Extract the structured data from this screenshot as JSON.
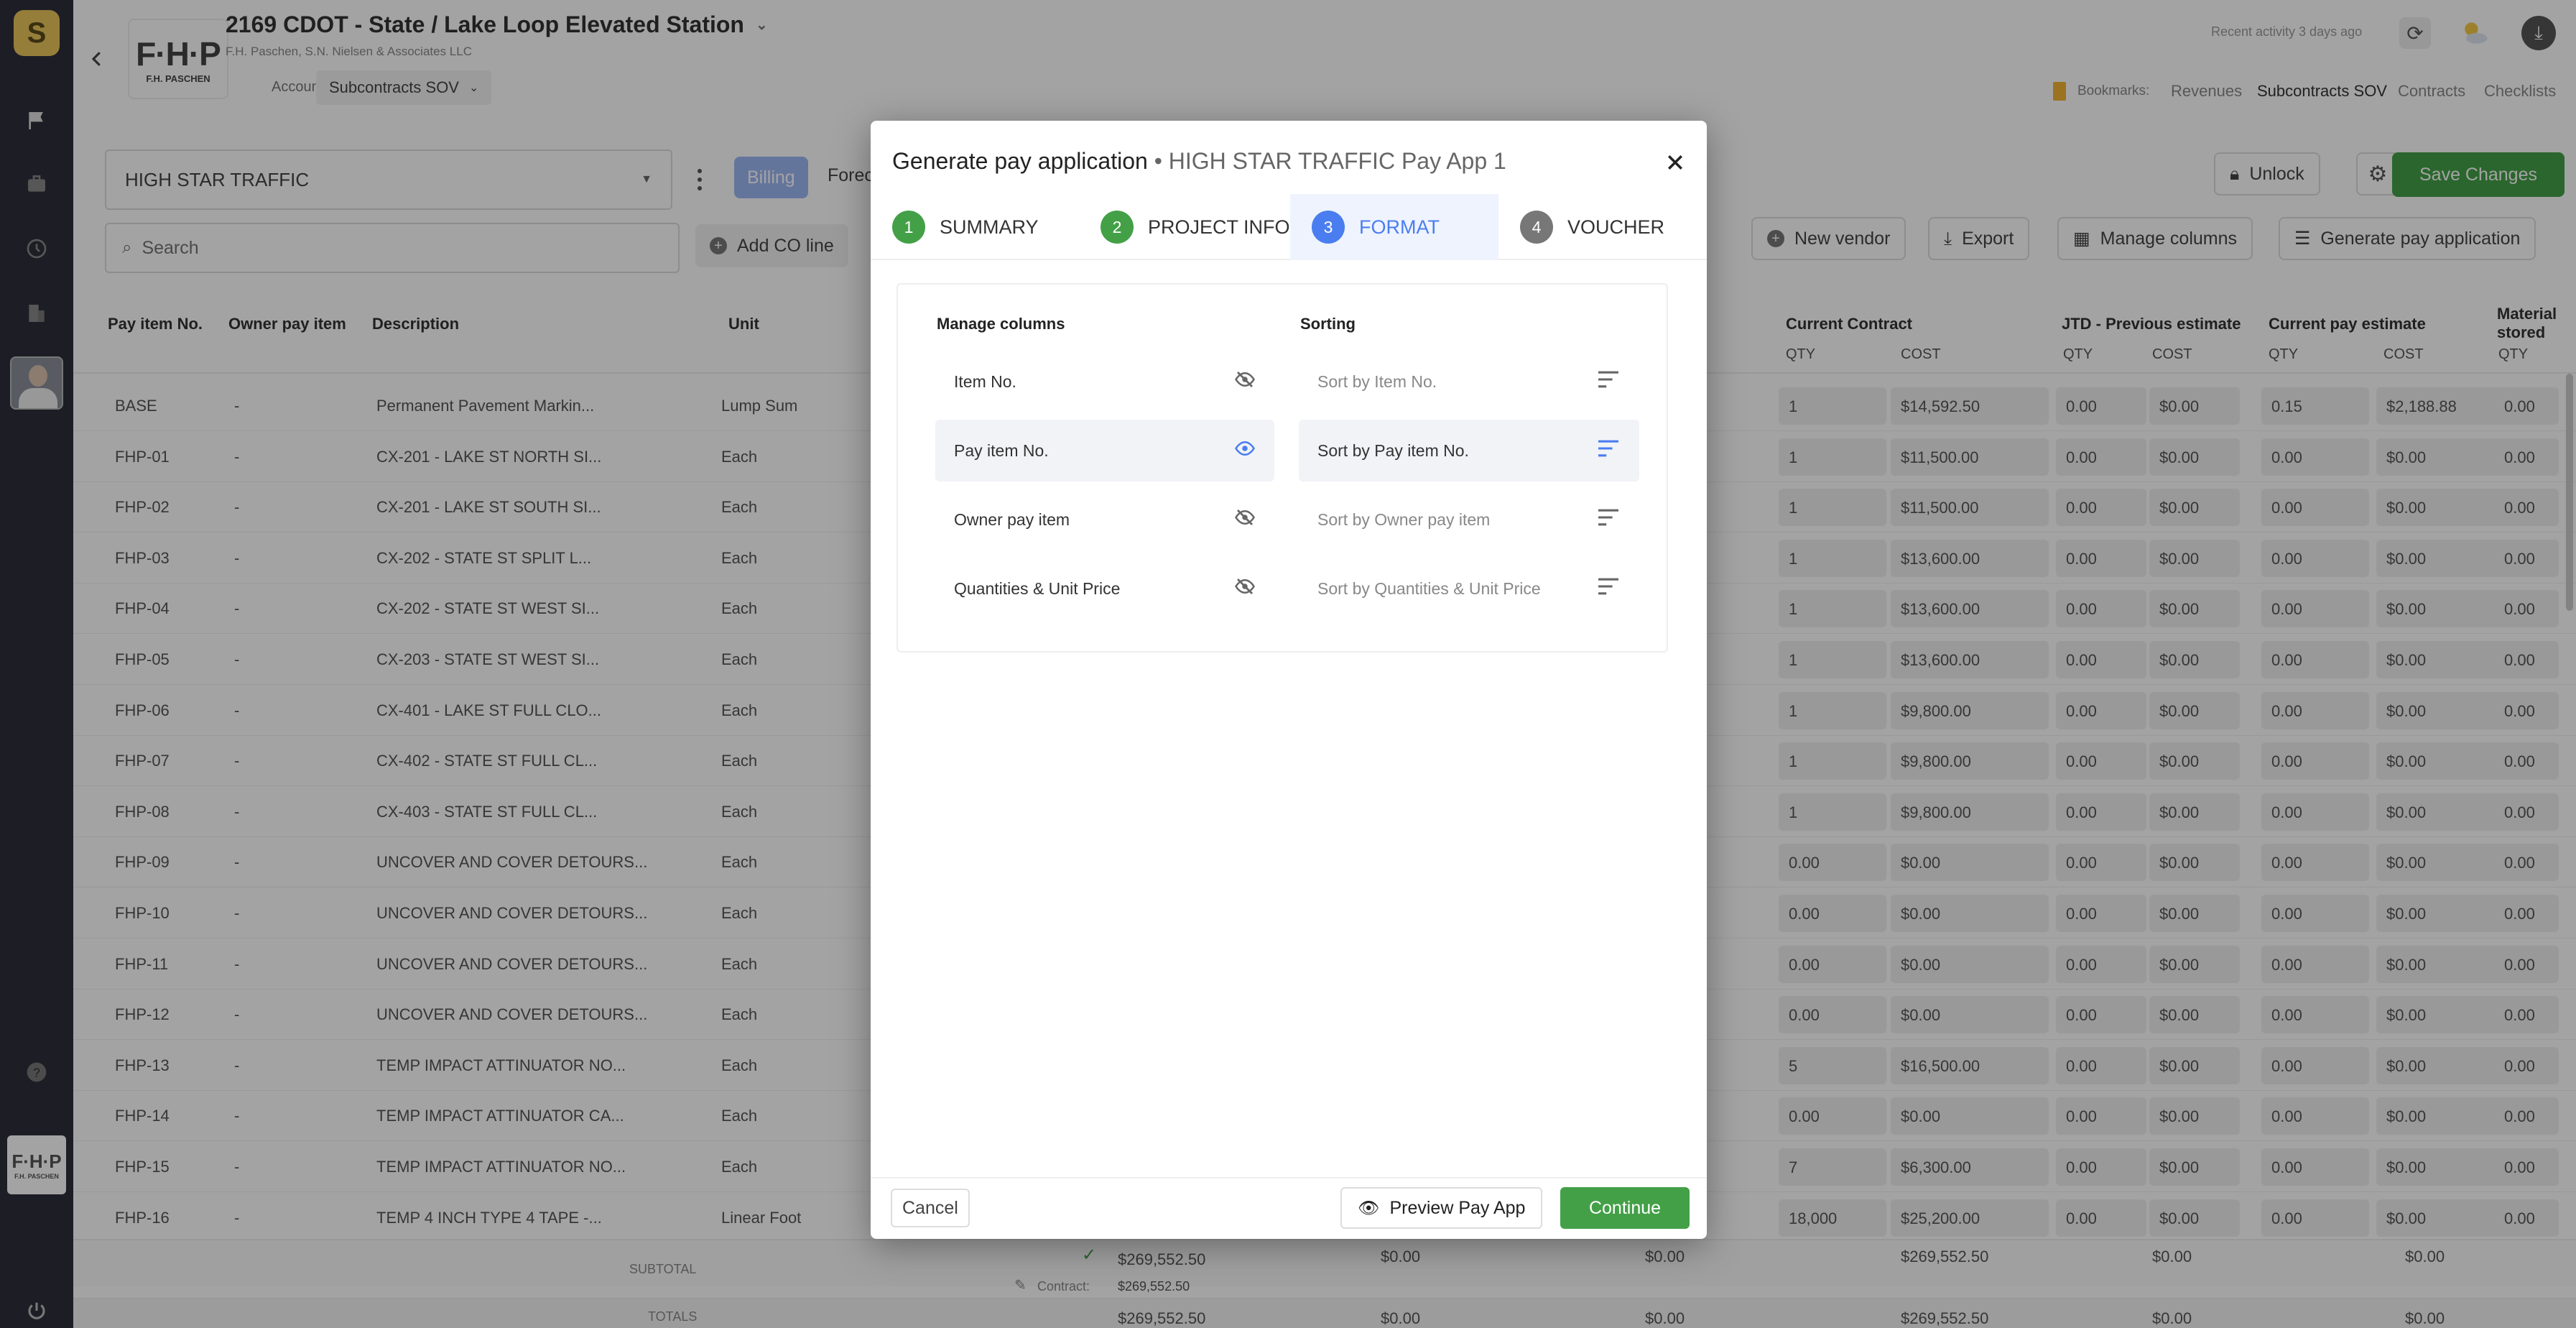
{
  "brand": {
    "logo_letter": "S",
    "company_logo_text": "F·H·P",
    "company_logo_sub": "F.H. PASCHEN"
  },
  "header": {
    "title": "2169 CDOT - State / Lake Loop Elevated Station",
    "subtitle": "F.H. Paschen, S.N. Nielsen & Associates LLC",
    "crumb_accounting": "Accounting",
    "crumb_select": "Subcontracts SOV",
    "recent_activity": "Recent activity 3 days ago",
    "bookmarks_label": "Bookmarks:",
    "bookmarks": [
      "Revenues",
      "Subcontracts SOV",
      "Contracts",
      "Checklists"
    ]
  },
  "toolbar": {
    "vendor_select": "HIGH STAR TRAFFIC",
    "tab_billing": "Billing",
    "tab_forecast": "Forec",
    "unlock": "Unlock",
    "save": "Save Changes",
    "search_placeholder": "Search",
    "add_co_line": "Add CO line",
    "new_vendor": "New vendor",
    "export": "Export",
    "manage_columns": "Manage columns",
    "generate_pay_app": "Generate pay application"
  },
  "table": {
    "headers": {
      "pay_item_no": "Pay item No.",
      "owner_pay_item": "Owner pay item",
      "description": "Description",
      "unit": "Unit",
      "current_contract": "Current Contract",
      "jtd_previous": "JTD - Previous estimate",
      "current_pay_estimate": "Current pay estimate",
      "material_stored": "Material stored",
      "qty": "QTY",
      "cost": "COST"
    },
    "rows": [
      {
        "no": "BASE",
        "owner": "-",
        "desc": "Permanent Pavement Markin...",
        "unit": "Lump Sum",
        "cc_qty": "1",
        "cc_cost": "$14,592.50",
        "jtd_qty": "0.00",
        "jtd_cost": "$0.00",
        "cur_qty": "0.15",
        "cur_cost": "$2,188.88",
        "mat_qty": "0.00"
      },
      {
        "no": "FHP-01",
        "owner": "-",
        "desc": "CX-201 - LAKE ST NORTH SI...",
        "unit": "Each",
        "cc_qty": "1",
        "cc_cost": "$11,500.00",
        "jtd_qty": "0.00",
        "jtd_cost": "$0.00",
        "cur_qty": "0.00",
        "cur_cost": "$0.00",
        "mat_qty": "0.00"
      },
      {
        "no": "FHP-02",
        "owner": "-",
        "desc": "CX-201 - LAKE ST SOUTH SI...",
        "unit": "Each",
        "cc_qty": "1",
        "cc_cost": "$11,500.00",
        "jtd_qty": "0.00",
        "jtd_cost": "$0.00",
        "cur_qty": "0.00",
        "cur_cost": "$0.00",
        "mat_qty": "0.00"
      },
      {
        "no": "FHP-03",
        "owner": "-",
        "desc": "CX-202 - STATE ST SPLIT L...",
        "unit": "Each",
        "cc_qty": "1",
        "cc_cost": "$13,600.00",
        "jtd_qty": "0.00",
        "jtd_cost": "$0.00",
        "cur_qty": "0.00",
        "cur_cost": "$0.00",
        "mat_qty": "0.00"
      },
      {
        "no": "FHP-04",
        "owner": "-",
        "desc": "CX-202 - STATE ST WEST SI...",
        "unit": "Each",
        "cc_qty": "1",
        "cc_cost": "$13,600.00",
        "jtd_qty": "0.00",
        "jtd_cost": "$0.00",
        "cur_qty": "0.00",
        "cur_cost": "$0.00",
        "mat_qty": "0.00"
      },
      {
        "no": "FHP-05",
        "owner": "-",
        "desc": "CX-203 - STATE ST WEST SI...",
        "unit": "Each",
        "cc_qty": "1",
        "cc_cost": "$13,600.00",
        "jtd_qty": "0.00",
        "jtd_cost": "$0.00",
        "cur_qty": "0.00",
        "cur_cost": "$0.00",
        "mat_qty": "0.00"
      },
      {
        "no": "FHP-06",
        "owner": "-",
        "desc": "CX-401 - LAKE ST FULL CLO...",
        "unit": "Each",
        "cc_qty": "1",
        "cc_cost": "$9,800.00",
        "jtd_qty": "0.00",
        "jtd_cost": "$0.00",
        "cur_qty": "0.00",
        "cur_cost": "$0.00",
        "mat_qty": "0.00"
      },
      {
        "no": "FHP-07",
        "owner": "-",
        "desc": "CX-402 - STATE ST FULL CL...",
        "unit": "Each",
        "cc_qty": "1",
        "cc_cost": "$9,800.00",
        "jtd_qty": "0.00",
        "jtd_cost": "$0.00",
        "cur_qty": "0.00",
        "cur_cost": "$0.00",
        "mat_qty": "0.00"
      },
      {
        "no": "FHP-08",
        "owner": "-",
        "desc": "CX-403 - STATE ST FULL CL...",
        "unit": "Each",
        "cc_qty": "1",
        "cc_cost": "$9,800.00",
        "jtd_qty": "0.00",
        "jtd_cost": "$0.00",
        "cur_qty": "0.00",
        "cur_cost": "$0.00",
        "mat_qty": "0.00"
      },
      {
        "no": "FHP-09",
        "owner": "-",
        "desc": "UNCOVER AND COVER DETOURS...",
        "unit": "Each",
        "cc_qty": "0.00",
        "cc_cost": "$0.00",
        "jtd_qty": "0.00",
        "jtd_cost": "$0.00",
        "cur_qty": "0.00",
        "cur_cost": "$0.00",
        "mat_qty": "0.00"
      },
      {
        "no": "FHP-10",
        "owner": "-",
        "desc": "UNCOVER AND COVER DETOURS...",
        "unit": "Each",
        "cc_qty": "0.00",
        "cc_cost": "$0.00",
        "jtd_qty": "0.00",
        "jtd_cost": "$0.00",
        "cur_qty": "0.00",
        "cur_cost": "$0.00",
        "mat_qty": "0.00"
      },
      {
        "no": "FHP-11",
        "owner": "-",
        "desc": "UNCOVER AND COVER DETOURS...",
        "unit": "Each",
        "cc_qty": "0.00",
        "cc_cost": "$0.00",
        "jtd_qty": "0.00",
        "jtd_cost": "$0.00",
        "cur_qty": "0.00",
        "cur_cost": "$0.00",
        "mat_qty": "0.00"
      },
      {
        "no": "FHP-12",
        "owner": "-",
        "desc": "UNCOVER AND COVER DETOURS...",
        "unit": "Each",
        "cc_qty": "0.00",
        "cc_cost": "$0.00",
        "jtd_qty": "0.00",
        "jtd_cost": "$0.00",
        "cur_qty": "0.00",
        "cur_cost": "$0.00",
        "mat_qty": "0.00"
      },
      {
        "no": "FHP-13",
        "owner": "-",
        "desc": "TEMP IMPACT ATTINUATOR NO...",
        "unit": "Each",
        "cc_qty": "5",
        "cc_cost": "$16,500.00",
        "jtd_qty": "0.00",
        "jtd_cost": "$0.00",
        "cur_qty": "0.00",
        "cur_cost": "$0.00",
        "mat_qty": "0.00"
      },
      {
        "no": "FHP-14",
        "owner": "-",
        "desc": "TEMP IMPACT ATTINUATOR CA...",
        "unit": "Each",
        "cc_qty": "0.00",
        "cc_cost": "$0.00",
        "jtd_qty": "0.00",
        "jtd_cost": "$0.00",
        "cur_qty": "0.00",
        "cur_cost": "$0.00",
        "mat_qty": "0.00"
      },
      {
        "no": "FHP-15",
        "owner": "-",
        "desc": "TEMP IMPACT ATTINUATOR NO...",
        "unit": "Each",
        "cc_qty": "7",
        "cc_cost": "$6,300.00",
        "jtd_qty": "0.00",
        "jtd_cost": "$0.00",
        "cur_qty": "0.00",
        "cur_cost": "$0.00",
        "mat_qty": "0.00"
      },
      {
        "no": "FHP-16",
        "owner": "-",
        "desc": "TEMP 4 INCH TYPE 4 TAPE -...",
        "unit": "Linear Foot",
        "cc_qty": "18,000",
        "cc_cost": "$25,200.00",
        "jtd_qty": "0.00",
        "jtd_cost": "$0.00",
        "cur_qty": "0.00",
        "cur_cost": "$0.00",
        "mat_qty": "0.00"
      }
    ],
    "subtotal_label": "SUBTOTAL",
    "totals_label": "TOTALS",
    "contract_label": "Contract:",
    "subtotal_values": [
      "$269,552.50",
      "$0.00",
      "$0.00",
      "$269,552.50",
      "$0.00",
      "$0.00"
    ],
    "contract_value": "$269,552.50",
    "totals_values": [
      "$269,552.50",
      "$0.00",
      "$0.00",
      "$269,552.50",
      "$0.00",
      "$0.00"
    ]
  },
  "modal": {
    "title": "Generate pay application",
    "subtitle": "• HIGH STAR TRAFFIC Pay App 1",
    "tabs": [
      {
        "num": "1",
        "label": "SUMMARY"
      },
      {
        "num": "2",
        "label": "PROJECT INFO"
      },
      {
        "num": "3",
        "label": "FORMAT"
      },
      {
        "num": "4",
        "label": "VOUCHER"
      }
    ],
    "manage_columns_title": "Manage columns",
    "sorting_title": "Sorting",
    "columns": [
      "Item No.",
      "Pay item No.",
      "Owner pay item",
      "Quantities & Unit Price"
    ],
    "sorts": [
      "Sort by Item No.",
      "Sort by Pay item No.",
      "Sort by Owner pay item",
      "Sort by Quantities & Unit Price"
    ],
    "cancel": "Cancel",
    "preview": "Preview Pay App",
    "continue": "Continue"
  },
  "colors": {
    "accent": "#4a7df0",
    "success": "#43a047",
    "sidebar": "#2e2e3a"
  }
}
